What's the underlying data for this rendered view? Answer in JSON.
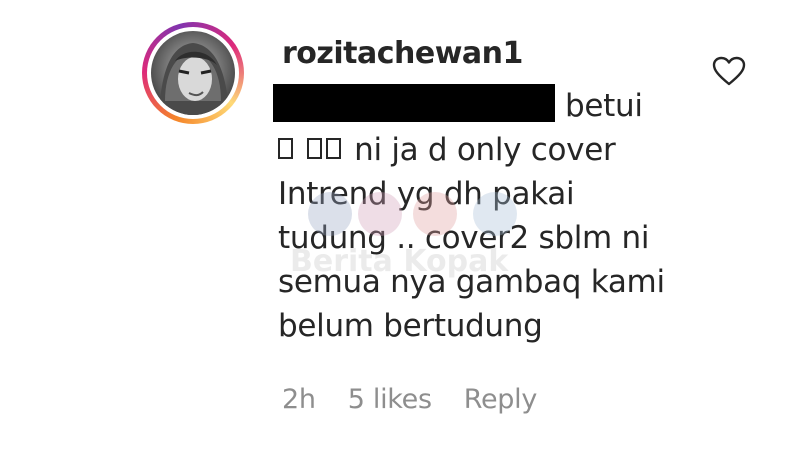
{
  "comment": {
    "username": "rozitachewan1",
    "lines": [
      "betui",
      "ni ja d only cover",
      "Intrend yg dh pakai",
      "tudung .. cover2 sblm ni",
      "semua nya gambaq kami",
      "belum bertudung"
    ],
    "timestamp": "2h",
    "likes": "5 likes",
    "reply_label": "Reply"
  },
  "watermark": {
    "text": "Berita Kopak"
  },
  "icons": {
    "like": "heart-outline-icon",
    "avatar": "profile-photo"
  },
  "colors": {
    "text": "#262626",
    "secondary": "#8e8e8e",
    "ring_start": "#f58529",
    "ring_end": "#dd2a7b"
  }
}
